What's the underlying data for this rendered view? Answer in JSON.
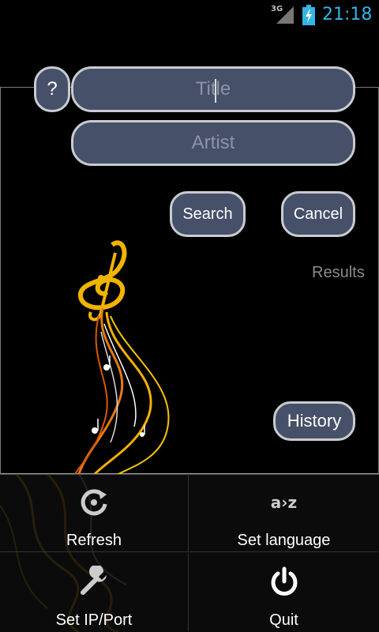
{
  "status_bar": {
    "network": "3G",
    "time": "21:18"
  },
  "form": {
    "help_label": "?",
    "title_placeholder": "Title",
    "artist_placeholder": "Artist",
    "search_label": "Search",
    "cancel_label": "Cancel",
    "results_label": "Results",
    "history_label": "History"
  },
  "menu": {
    "refresh_label": "Refresh",
    "set_language_label": "Set language",
    "set_language_icon_text": "a›z",
    "set_ip_port_label": "Set IP/Port",
    "quit_label": "Quit"
  },
  "colors": {
    "accent_blue": "#33b5e5",
    "button_fill": "#465069",
    "button_border": "#c9cbd1"
  }
}
